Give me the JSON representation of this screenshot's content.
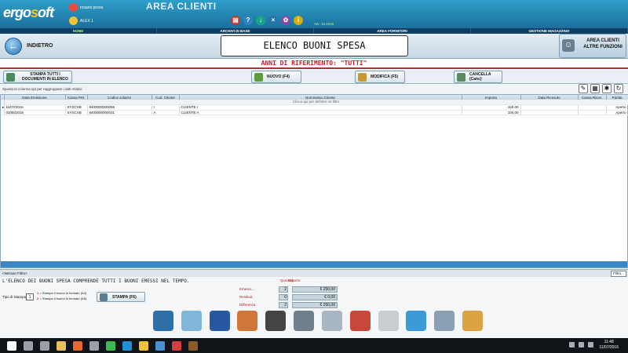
{
  "header": {
    "logo_left": "ergo",
    "logo_o": "s",
    "logo_right": "oft",
    "user_name": "rosario prova",
    "user_code": "ALEX 1",
    "area_title": "AREA CLIENTI",
    "version": "Ver. 16.0030",
    "icons": [
      {
        "name": "calendar-icon",
        "glyph": "▤",
        "color": "#c0392b"
      },
      {
        "name": "help-icon",
        "glyph": "?",
        "color": "#2e86c1"
      },
      {
        "name": "download-icon",
        "glyph": "↓",
        "color": "#17a589"
      },
      {
        "name": "close-circle-icon",
        "glyph": "×",
        "color": "#2874a6"
      },
      {
        "name": "settings-icon",
        "glyph": "✿",
        "color": "#8e44ad"
      },
      {
        "name": "info-icon",
        "glyph": "i",
        "color": "#d4ac0d"
      }
    ]
  },
  "menubar": {
    "items": [
      {
        "label": "HOME",
        "active": true
      },
      {
        "label": "ARCHIVI DI BASE",
        "active": false
      },
      {
        "label": "AREA FORNITORI",
        "active": false
      },
      {
        "label": "GESTIONE MAGAZZINO",
        "active": false
      }
    ]
  },
  "titlebar": {
    "back_label": "INDIETRO",
    "page_title": "ELENCO BUONI SPESA",
    "altre_label": "AREA CLIENTI ALTRE FUNZIONI",
    "subtitle": "ANNI DI RIFERIMENTO: \"TUTTI\""
  },
  "toolbar": {
    "stampa_tutti": "STAMPA TUTTI I DOCUMENTI IN ELENCO",
    "nuovo": "NUOVO (F4)",
    "modifica": "MODIFICA (F5)",
    "cancella": "CANCELLA (Canc)"
  },
  "grid": {
    "group_hint": "Sposta la colonna qui per raggruppare i dati relativi",
    "filter_hint": "Clicca qui per definire un filtro",
    "columns": [
      "Data Emissione",
      "Cassa Prtt.",
      "Codice a Barre",
      "Cod. Cliente",
      "Nominativo Cliente",
      "Importo",
      "Data Ricevuto",
      "Cassa Ricev.",
      "Partita"
    ],
    "rows": [
      {
        "data": "11/07/2016",
        "cassa": "SYSCXB",
        "barcode": "8400000000055",
        "cod": "I",
        "cliente": "CLIENTE I",
        "importo": "150,00",
        "ricevuto": "",
        "cassa_ricev": "",
        "partita": "Aperto"
      },
      {
        "data": "03/05/2016",
        "cassa": "SYSCXB",
        "barcode": "8400000000031",
        "cod": "A",
        "cliente": "CLIENTE A",
        "importo": "100,00",
        "ricevuto": "",
        "cassa_ricev": "",
        "partita": "Aperto"
      }
    ],
    "filter_bar": "<Nessun Filtro>",
    "filter_button": "Filtro..."
  },
  "bottom": {
    "info": "L'ELENCO DEI BUONI SPESA  COMPRENDE TUTTI I BUONI EMESSI NEL TEMPO.",
    "tipo_label": "Tipo di Stampa",
    "tipo_value": "1",
    "opt1": "= Stampa il buono in formato (A4)",
    "opt2": "= Stampa il buono in formato (A5)",
    "stampa_btn": "STAMPA (F6)",
    "totals": {
      "qty_head": "Quantità",
      "imp_head": "Importo",
      "rows": [
        {
          "label": "Emessi....",
          "qty": "2",
          "imp": "€ 250,00"
        },
        {
          "label": "Restituit..",
          "qty": "0",
          "imp": "€ 0,00"
        },
        {
          "label": "Differenza",
          "qty": "2",
          "imp": "€ 250,00"
        }
      ]
    }
  },
  "launcher": [
    {
      "name": "clienti-launcher-icon",
      "color": "#2f6fa8"
    },
    {
      "name": "card-launcher-icon",
      "color": "#7fb6d9"
    },
    {
      "name": "door-launcher-icon",
      "color": "#2858a0"
    },
    {
      "name": "report-launcher-icon",
      "color": "#d0763a"
    },
    {
      "name": "security-launcher-icon",
      "color": "#444444"
    },
    {
      "name": "save-launcher-icon",
      "color": "#6f7f8c"
    },
    {
      "name": "printer-launcher-icon",
      "color": "#a7b6c2"
    },
    {
      "name": "calendar-launcher-icon",
      "color": "#c9463b"
    },
    {
      "name": "clock-launcher-icon",
      "color": "#c8cdd2"
    },
    {
      "name": "tag-launcher-icon",
      "color": "#3c9bd6"
    },
    {
      "name": "search-launcher-icon",
      "color": "#8aa0b4"
    },
    {
      "name": "tools-launcher-icon",
      "color": "#d9a441"
    }
  ],
  "taskbar": {
    "time": "11:48",
    "date": "11/07/2016",
    "apps": [
      {
        "name": "start-icon",
        "color": "#ffffff"
      },
      {
        "name": "search-taskbar-icon",
        "color": "#9aa0a6"
      },
      {
        "name": "task-view-icon",
        "color": "#9aa0a6"
      },
      {
        "name": "explorer-icon",
        "color": "#e8c15a"
      },
      {
        "name": "firefox-icon",
        "color": "#e66b2a"
      },
      {
        "name": "store-icon",
        "color": "#9aa0a6"
      },
      {
        "name": "chrome-icon",
        "color": "#3cba54"
      },
      {
        "name": "ie-icon",
        "color": "#1e90d6"
      },
      {
        "name": "ergosoft-taskbar-icon",
        "color": "#f1c232"
      },
      {
        "name": "app2-icon",
        "color": "#4a8fd1"
      },
      {
        "name": "app3-icon",
        "color": "#d13f3f"
      },
      {
        "name": "app4-icon",
        "color": "#8a5a2b"
      }
    ]
  }
}
